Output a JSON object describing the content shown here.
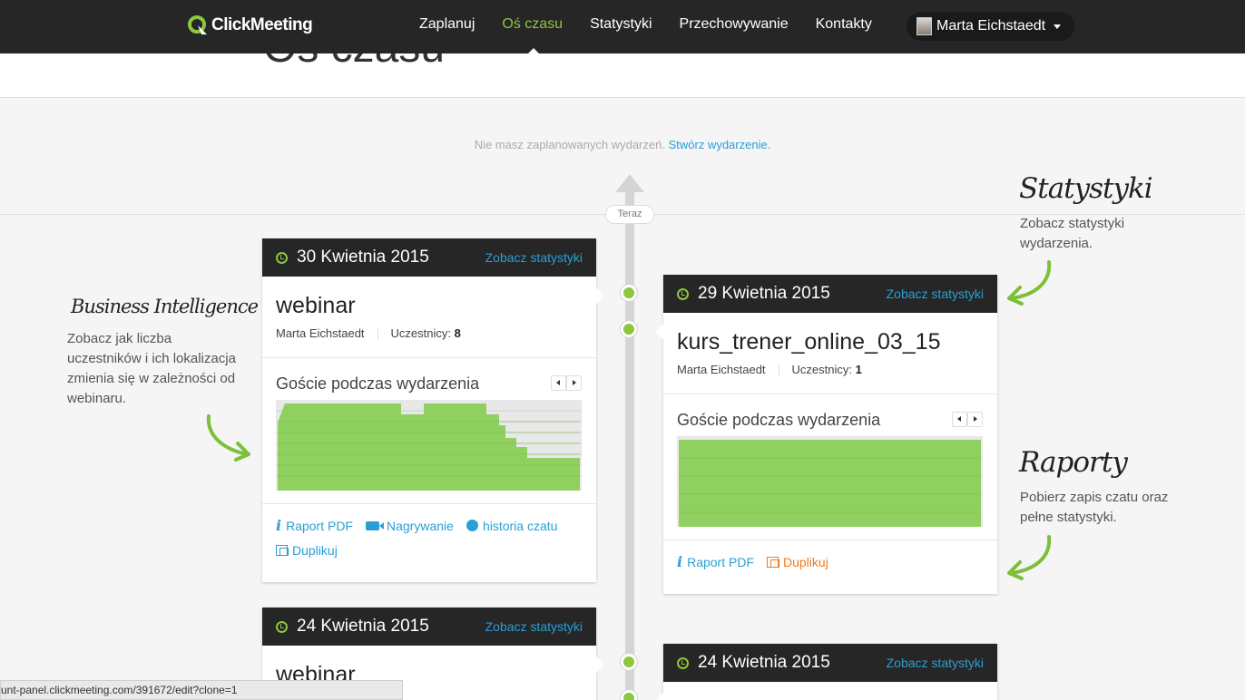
{
  "app": {
    "logo_text": "ClickMeeting",
    "accent": "#8dc63f",
    "link_color": "#2a9fd6"
  },
  "nav": {
    "items": [
      {
        "label": "Zaplanuj"
      },
      {
        "label": "Oś czasu"
      },
      {
        "label": "Statystyki"
      },
      {
        "label": "Przechowywanie"
      },
      {
        "label": "Kontakty"
      }
    ],
    "active_index": 1,
    "user_name": "Marta Eichstaedt"
  },
  "header": {
    "title": "Oś czasu"
  },
  "empty_state": {
    "text": "Nie masz zaplanowanych wydarzeń.",
    "link": "Stwórz wydarzenie."
  },
  "timeline": {
    "now_label": "Teraz"
  },
  "cards": [
    {
      "date": "30 Kwietnia 2015",
      "stats_link": "Zobacz statystyki",
      "title": "webinar",
      "host": "Marta Eichstaedt",
      "participants_label": "Uczestnicy:",
      "participants": "8",
      "chart_title": "Goście podczas wydarzenia",
      "actions": [
        {
          "label": "Raport PDF",
          "icon": "info-icon"
        },
        {
          "label": "Nagrywanie",
          "icon": "camera-icon"
        },
        {
          "label": "historia czatu",
          "icon": "chat-icon"
        },
        {
          "label": "Duplikuj",
          "icon": "duplicate-icon"
        }
      ]
    },
    {
      "date": "29 Kwietnia 2015",
      "stats_link": "Zobacz statystyki",
      "title": "kurs_trener_online_03_15",
      "host": "Marta Eichstaedt",
      "participants_label": "Uczestnicy:",
      "participants": "1",
      "chart_title": "Goście podczas wydarzenia",
      "actions": [
        {
          "label": "Raport PDF",
          "icon": "info-icon"
        },
        {
          "label": "Duplikuj",
          "icon": "duplicate-icon"
        }
      ]
    },
    {
      "date": "24 Kwietnia 2015",
      "stats_link": "Zobacz statystyki",
      "title": "webinar"
    },
    {
      "date": "24 Kwietnia 2015",
      "stats_link": "Zobacz statystyki"
    }
  ],
  "notes": {
    "bi": {
      "title": "Business Intelligence",
      "text": "Zobacz jak liczba uczestników i ich lokalizacja zmienia się w zależności od webinaru."
    },
    "stats": {
      "title": "Statystyki",
      "text": "Zobacz statystyki wydarzenia."
    },
    "reports": {
      "title": "Raporty",
      "text": "Pobierz zapis czatu oraz pełne statystyki."
    }
  },
  "status_bar": {
    "url": "unt-panel.clickmeeting.com/391672/edit?clone=1"
  }
}
